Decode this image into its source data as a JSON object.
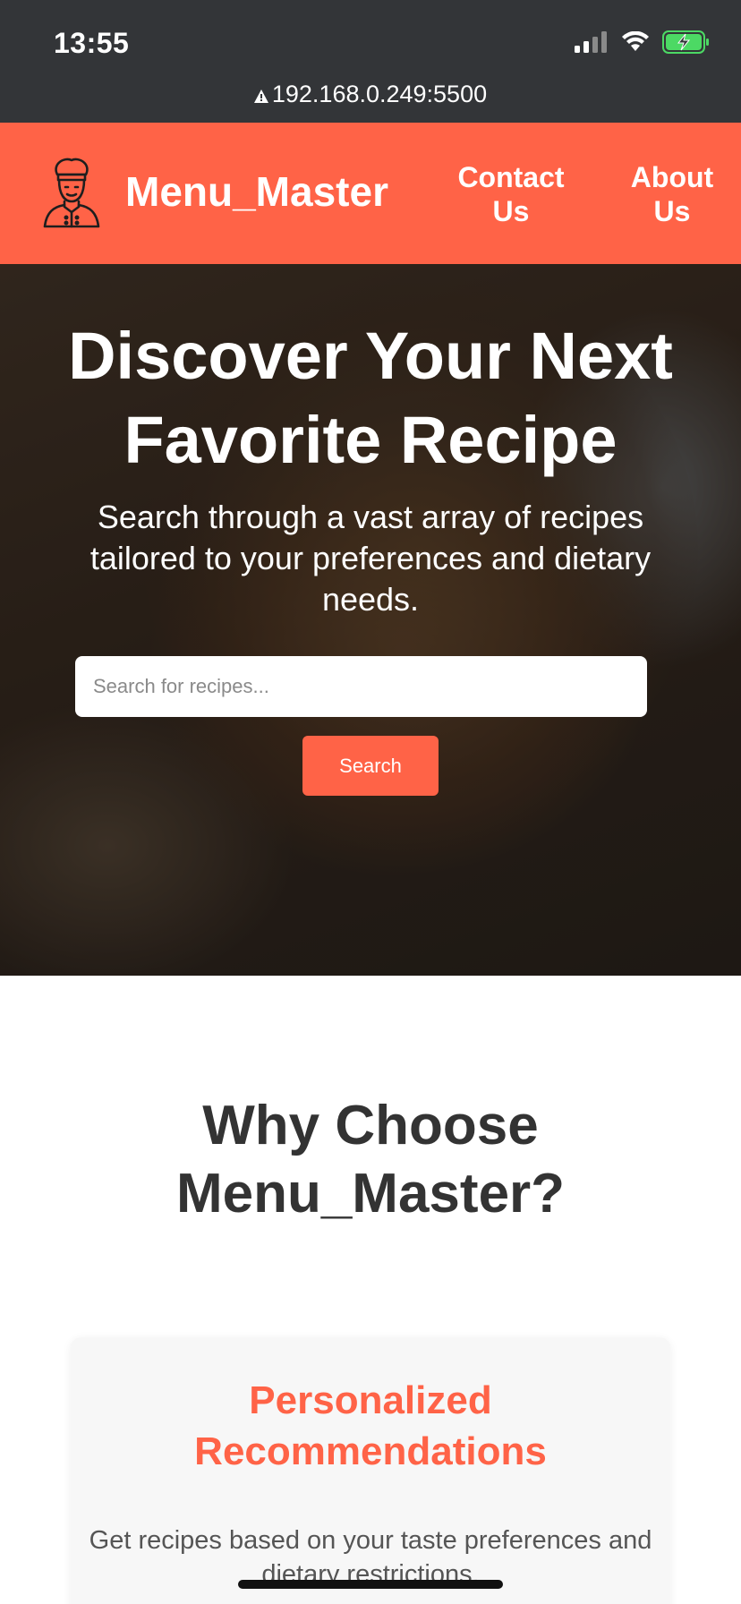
{
  "status_bar": {
    "time": "13:55",
    "url": "192.168.0.249:5500",
    "icons": [
      "signal-icon",
      "wifi-icon",
      "battery-charging-icon"
    ]
  },
  "header": {
    "brand": "Menu_Master",
    "logo_icon": "chef-icon",
    "nav": {
      "contact_line1": "Contact",
      "contact_line2": "Us",
      "about_line1": "About",
      "about_line2": "Us"
    },
    "accent_color": "#ff6347"
  },
  "hero": {
    "title_line1": "Discover Your Next",
    "title_line2": "Favorite Recipe",
    "subtitle": "Search through a vast array of recipes tailored to your preferences and dietary needs.",
    "search_placeholder": "Search for recipes...",
    "search_value": "",
    "search_button": "Search"
  },
  "why": {
    "title_line1": "Why Choose",
    "title_line2": "Menu_Master?"
  },
  "features": [
    {
      "title_line1": "Personalized",
      "title_line2": "Recommendations",
      "description": "Get recipes based on your taste preferences and dietary restrictions."
    }
  ]
}
